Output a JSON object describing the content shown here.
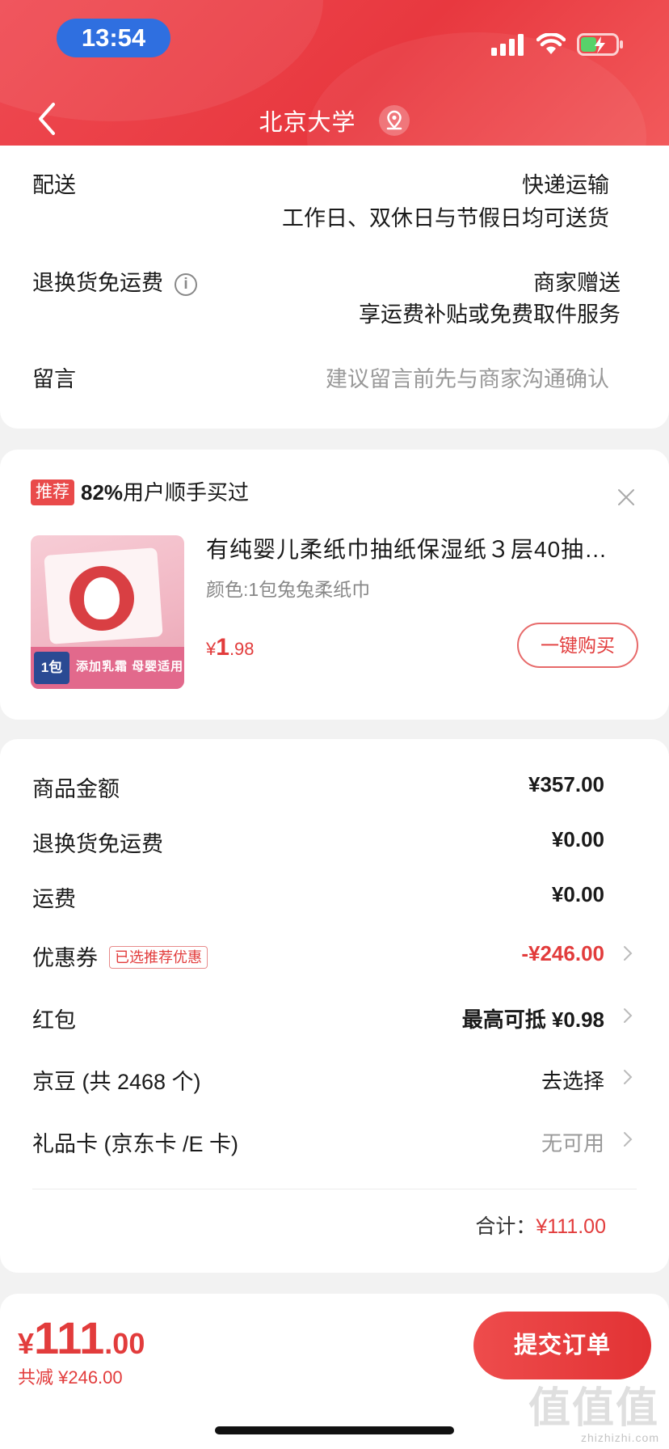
{
  "status_bar": {
    "time": "13:54"
  },
  "nav": {
    "title": "北京大学"
  },
  "delivery": {
    "label": "配送",
    "method": "快递运输",
    "schedule": "工作日、双休日与节假日均可送货"
  },
  "return_shipping": {
    "label": "退换货免运费",
    "info_icon": "i",
    "provider": "商家赠送",
    "desc": "享运费补贴或免费取件服务"
  },
  "message": {
    "label": "留言",
    "placeholder": "建议留言前先与商家沟通确认"
  },
  "recommend": {
    "tag": "推荐",
    "percent": "82%",
    "text": "用户顺手买过",
    "product_title": "有纯婴儿柔纸巾抽纸保湿纸３层40抽…",
    "product_spec": "颜色:1包兔兔柔纸巾",
    "price_symbol": "¥",
    "price_int": "1",
    "price_dec": ".98",
    "buy_label": "一键购买",
    "image_text_band": "添加乳霜 母婴适用",
    "image_text_tag": "1包"
  },
  "summary": {
    "goods_amount_label": "商品金额",
    "goods_amount": "¥357.00",
    "return_fee_label": "退换货免运费",
    "return_fee": "¥0.00",
    "shipping_label": "运费",
    "shipping": "¥0.00",
    "coupon_label": "优惠券",
    "coupon_badge": "已选推荐优惠",
    "coupon_value": "-¥246.00",
    "redpacket_label": "红包",
    "redpacket_value": "最高可抵 ¥0.98",
    "jingdou_label": "京豆 (共 2468 个)",
    "jingdou_value": "去选择",
    "giftcard_label": "礼品卡 (京东卡 /E 卡)",
    "giftcard_value": "无可用",
    "total_label": "合计：",
    "total_value": "¥111.00"
  },
  "bottom": {
    "currency": "¥",
    "price_int": "111",
    "price_dec": ".00",
    "saved": "共减 ¥246.00",
    "submit_label": "提交订单"
  },
  "watermark": {
    "big": "值值值",
    "small": "zhizhizhi.com"
  },
  "colors": {
    "brand_red": "#e23c3c",
    "header_red": "#ef4a52"
  }
}
